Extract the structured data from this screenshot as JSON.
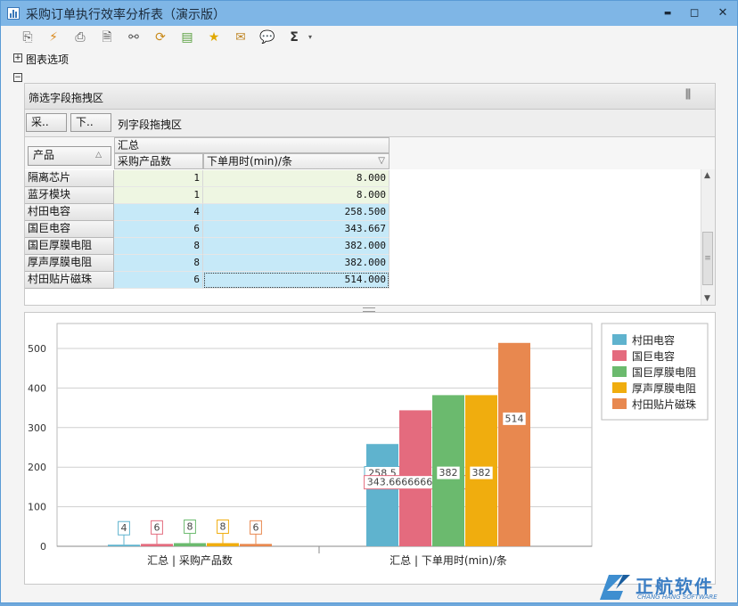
{
  "window": {
    "title": "采购订单执行效率分析表（演示版）",
    "minimize": "▬",
    "restore": "◻",
    "close": "✕"
  },
  "toolbar": {
    "icons": [
      "export-icon",
      "refresh-icon",
      "print-icon",
      "preview-icon",
      "find-icon",
      "sync-icon",
      "save-icon",
      "star-icon",
      "mail-icon",
      "comment-icon",
      "sum-icon",
      "dropdown-icon"
    ]
  },
  "chart_options_label": "图表选项",
  "pivot": {
    "filter_area_label": "筛选字段拖拽区",
    "filter_buttons": [
      "采..",
      "下.."
    ],
    "column_area_label": "列字段拖拽区",
    "row_field": "产品",
    "group_header": "汇总",
    "columns": [
      "采购产品数",
      "下单用时(min)/条"
    ],
    "rows": [
      {
        "name": "隔离芯片",
        "count": "1",
        "time": "8.000"
      },
      {
        "name": "蓝牙模块",
        "count": "1",
        "time": "8.000"
      },
      {
        "name": "村田电容",
        "count": "4",
        "time": "258.500"
      },
      {
        "name": "国巨电容",
        "count": "6",
        "time": "343.667"
      },
      {
        "name": "国巨厚膜电阻",
        "count": "8",
        "time": "382.000"
      },
      {
        "name": "厚声厚膜电阻",
        "count": "8",
        "time": "382.000"
      },
      {
        "name": "村田贴片磁珠",
        "count": "6",
        "time": "514.000"
      }
    ]
  },
  "chart_data": {
    "type": "bar",
    "categories": [
      "汇总 | 采购产品数",
      "汇总 | 下单用时(min)/条"
    ],
    "ylim": [
      0,
      500
    ],
    "yticks": [
      0,
      100,
      200,
      300,
      400,
      500
    ],
    "grid": true,
    "legend_position": "right",
    "series": [
      {
        "name": "村田电容",
        "color": "#5fb3ce",
        "values": [
          4,
          258.5
        ],
        "labels": [
          "4",
          "258.5"
        ]
      },
      {
        "name": "国巨电容",
        "color": "#e46b7e",
        "values": [
          6,
          343.666666666667
        ],
        "labels": [
          "6",
          "343.666666666667"
        ]
      },
      {
        "name": "国巨厚膜电阻",
        "color": "#6bba6e",
        "values": [
          8,
          382
        ],
        "labels": [
          "8",
          "382"
        ]
      },
      {
        "name": "厚声厚膜电阻",
        "color": "#f0ad0e",
        "values": [
          8,
          382
        ],
        "labels": [
          "8",
          "382"
        ]
      },
      {
        "name": "村田贴片磁珠",
        "color": "#e8884f",
        "values": [
          6,
          514
        ],
        "labels": [
          "6",
          "514"
        ]
      }
    ]
  },
  "watermark": {
    "brand": "正航软件",
    "sub": "CHANG HANG SOFTWARE"
  }
}
